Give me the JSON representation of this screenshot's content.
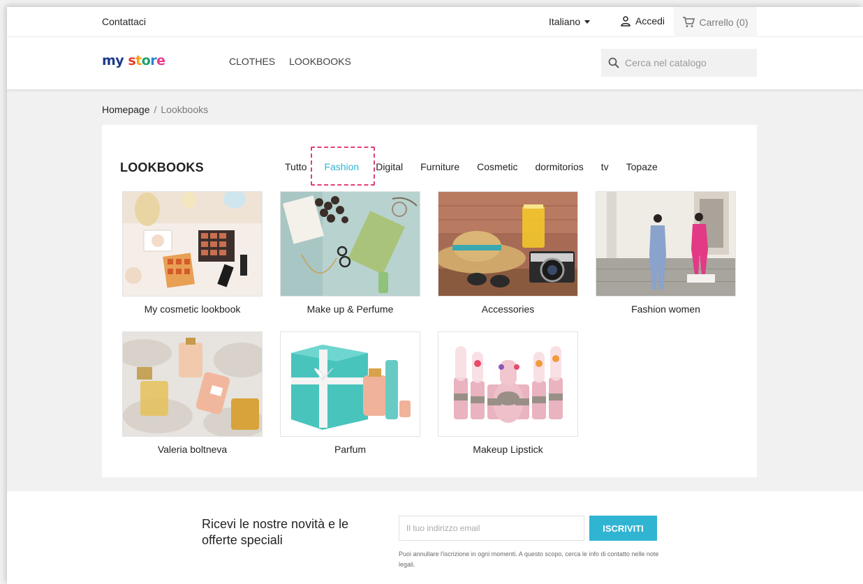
{
  "topbar": {
    "contact": "Contattaci",
    "language": "Italiano",
    "login": "Accedi",
    "cart": "Carrello (0)"
  },
  "header": {
    "logo_my": "my",
    "logo_store": [
      "s",
      "t",
      "o",
      "r",
      "e"
    ],
    "nav": [
      "CLOTHES",
      "LOOKBOOKS"
    ],
    "search_placeholder": "Cerca nel catalogo"
  },
  "breadcrumb": {
    "home": "Homepage",
    "separator": "/",
    "current": "Lookbooks"
  },
  "lookbooks": {
    "title": "LOOKBOOKS",
    "filters": [
      "Tutto",
      "Fashion",
      "Digital",
      "Furniture",
      "Cosmetic",
      "dormitorios",
      "tv",
      "Topaze"
    ],
    "active_filter": "Fashion",
    "items": [
      {
        "title": "My cosmetic lookbook",
        "thumb": "cosmetic-palette-photo"
      },
      {
        "title": "Make up & Perfume",
        "thumb": "makeup-perfume-flatlay-photo"
      },
      {
        "title": "Accessories",
        "thumb": "hat-camera-sunglasses-photo"
      },
      {
        "title": "Fashion women",
        "thumb": "women-in-suits-photo"
      },
      {
        "title": "Valeria boltneva",
        "thumb": "perfume-bottles-fur-photo"
      },
      {
        "title": "Parfum",
        "thumb": "tiffany-perfume-gift-box-photo"
      },
      {
        "title": "Makeup Lipstick",
        "thumb": "flower-lipsticks-photo"
      }
    ]
  },
  "newsletter": {
    "title": "Ricevi le nostre novità e le offerte speciali",
    "email_placeholder": "Il tuo indirizzo email",
    "subscribe": "ISCRIVITI",
    "note": "Puoi annullare l'iscrizione in ogni momenti. A questo scopo, cerca le info di contatto nelle note legali."
  },
  "colors": {
    "accent": "#2fb5d2",
    "highlight": "#e0407a"
  }
}
